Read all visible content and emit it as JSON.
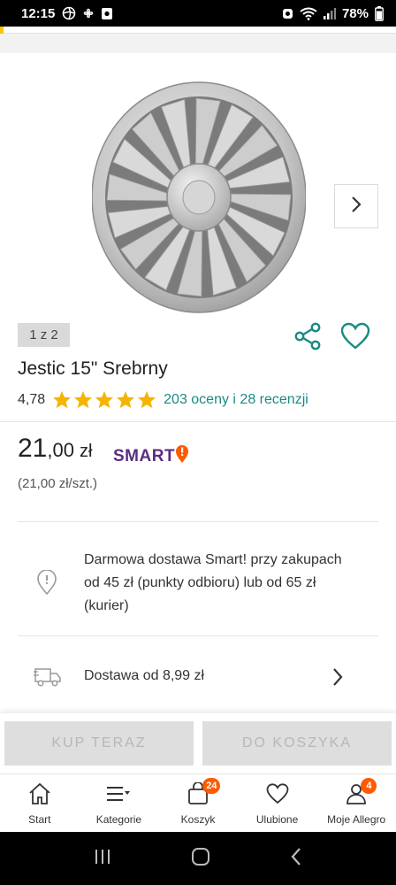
{
  "status_bar": {
    "time": "12:15",
    "battery": "78%"
  },
  "gallery": {
    "pager": "1 z 2"
  },
  "product": {
    "title": "Jestic 15\" Srebrny",
    "rating": "4,78",
    "stars": 5,
    "reviews_link": "203 oceny i 28 recenzji",
    "price_int": "21",
    "price_dec": ",00",
    "currency": "zł",
    "smart_label": "SMART",
    "unit_price": "(21,00 zł/szt.)"
  },
  "delivery": {
    "free_info": "Darmowa dostawa Smart! przy zakupach od 45 zł (punkty odbioru) lub od 65 zł (kurier)",
    "cost": "Dostawa od 8,99 zł"
  },
  "actions": {
    "buy_now": "KUP TERAZ",
    "add_to_cart": "DO KOSZYKA"
  },
  "bottom_nav": {
    "items": [
      {
        "label": "Start",
        "icon": "home-icon"
      },
      {
        "label": "Kategorie",
        "icon": "menu-icon"
      },
      {
        "label": "Koszyk",
        "icon": "bag-icon",
        "badge": "24"
      },
      {
        "label": "Ulubione",
        "icon": "heart-icon"
      },
      {
        "label": "Moje Allegro",
        "icon": "user-icon",
        "badge": "4"
      }
    ]
  },
  "colors": {
    "accent": "#1a8a84",
    "smart": "#5a2d82",
    "smart_dot": "#ff5a00",
    "star": "#f5b400",
    "badge": "#ff5a00"
  }
}
